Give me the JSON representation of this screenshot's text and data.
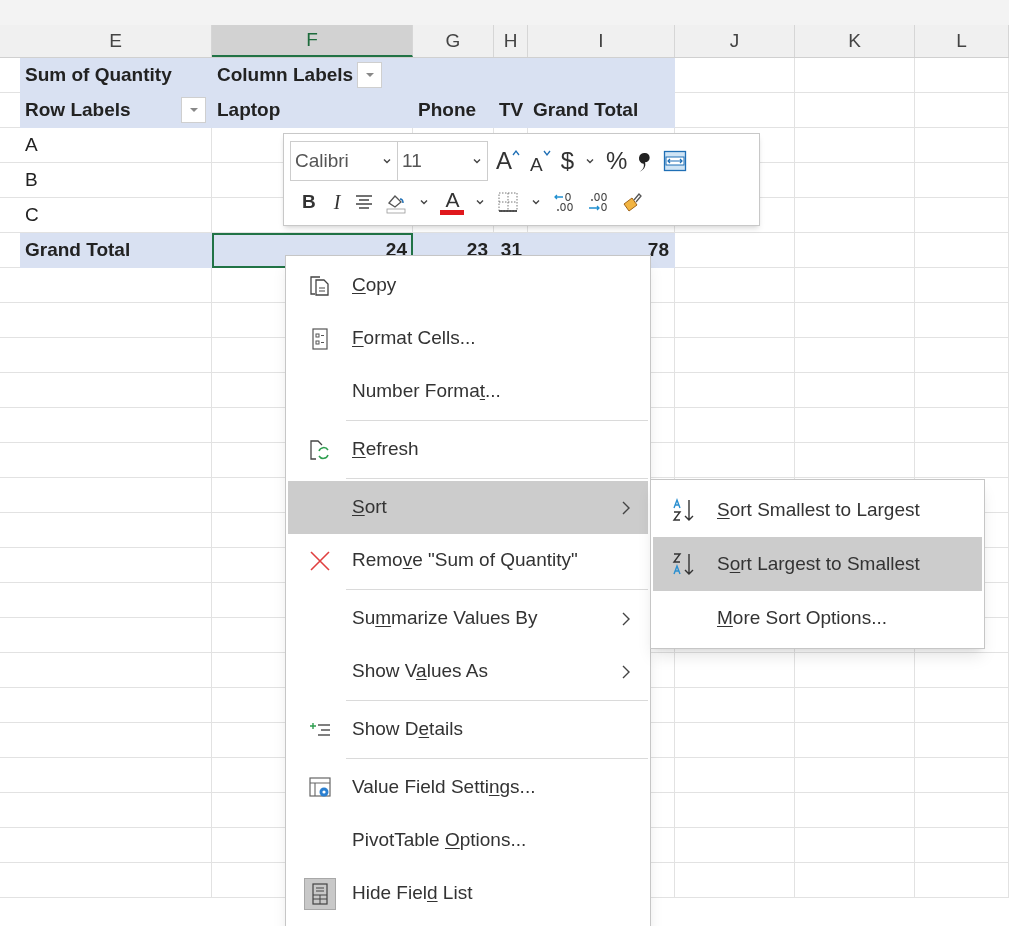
{
  "columns": [
    {
      "label": "E",
      "selected": false
    },
    {
      "label": "F",
      "selected": true
    },
    {
      "label": "G",
      "selected": false
    },
    {
      "label": "H",
      "selected": false
    },
    {
      "label": "I",
      "selected": false
    },
    {
      "label": "J",
      "selected": false
    },
    {
      "label": "K",
      "selected": false
    },
    {
      "label": "L",
      "selected": false
    }
  ],
  "pivot_rows": [
    {
      "kind": "header",
      "cells": [
        {
          "text": "Sum of Quantity",
          "selected": false
        },
        {
          "text": "Column Labels",
          "filter_button": true,
          "selected": false
        },
        null,
        null,
        null
      ]
    },
    {
      "kind": "header",
      "cells": [
        {
          "text": "Row Labels",
          "filter_button": true,
          "selected": false
        },
        {
          "text": "Laptop",
          "selected": false
        },
        {
          "text": "Phone",
          "selected": false
        },
        {
          "text": "TV",
          "selected": false
        },
        {
          "text": "Grand Total",
          "selected": false
        }
      ]
    },
    {
      "kind": "item",
      "cells": [
        {
          "text": "A",
          "selected": false
        }
      ]
    },
    {
      "kind": "item",
      "cells": [
        {
          "text": "B",
          "selected": false
        }
      ]
    },
    {
      "kind": "item",
      "cells": [
        {
          "text": "C",
          "selected": false
        }
      ]
    },
    {
      "kind": "total",
      "cells": [
        {
          "text": "Grand Total",
          "selected": false
        },
        {
          "text": "24",
          "selected": true
        },
        {
          "text": "23",
          "selected": false
        },
        {
          "text": "31",
          "selected": false
        },
        {
          "text": "78",
          "selected": false
        }
      ]
    }
  ],
  "mini_toolbar": {
    "font": {
      "value": "Calibri"
    },
    "size": {
      "value": "11"
    },
    "row_1": [
      {
        "kind": "grow_font",
        "text": "A"
      },
      {
        "kind": "shrink_font",
        "text": "A"
      },
      {
        "kind": "currency",
        "text": "$"
      },
      {
        "kind": "caret"
      },
      {
        "kind": "percent",
        "text": "%"
      },
      {
        "kind": "comma"
      },
      {
        "kind": "merge"
      }
    ],
    "row_2": [
      {
        "kind": "bold",
        "text": "B"
      },
      {
        "kind": "italic",
        "text": "I"
      },
      {
        "kind": "align"
      },
      {
        "kind": "fill"
      },
      {
        "kind": "caret"
      },
      {
        "kind": "font_color",
        "text": "A"
      },
      {
        "kind": "caret"
      },
      {
        "kind": "borders"
      },
      {
        "kind": "caret"
      },
      {
        "kind": "decrease_decimal"
      },
      {
        "kind": "increase_decimal"
      },
      {
        "kind": "format_painter"
      }
    ]
  },
  "context_menu": [
    {
      "kind": "copy",
      "label": {
        "key": "C",
        "after": "opy"
      },
      "submenu": false,
      "selected": false,
      "checked": false,
      "separator_after": false
    },
    {
      "kind": "format_cells",
      "label": {
        "key": "F",
        "after": "ormat Cells..."
      },
      "submenu": false,
      "selected": false,
      "checked": false,
      "separator_after": false
    },
    {
      "label": {
        "before": "Number Forma",
        "key": "t",
        "after": "..."
      },
      "submenu": false,
      "selected": false,
      "checked": false,
      "separator_after": true
    },
    {
      "kind": "refresh",
      "label": {
        "key": "R",
        "after": "efresh"
      },
      "submenu": false,
      "selected": false,
      "checked": false,
      "separator_after": true
    },
    {
      "label": {
        "key": "S",
        "after": "ort"
      },
      "submenu": true,
      "selected": true,
      "checked": false,
      "separator_after": false
    },
    {
      "kind": "remove",
      "label": {
        "before": "Remo",
        "key": "v",
        "after": "e \"Sum of Quantity\""
      },
      "submenu": false,
      "selected": false,
      "checked": false,
      "separator_after": true
    },
    {
      "label": {
        "before": "Su",
        "key": "m",
        "after": "marize Values By"
      },
      "submenu": true,
      "selected": false,
      "checked": false,
      "separator_after": false
    },
    {
      "label": {
        "before": "Show V",
        "key": "a",
        "after": "lues As"
      },
      "submenu": true,
      "selected": false,
      "checked": false,
      "separator_after": true
    },
    {
      "kind": "show_details",
      "label": {
        "before": "Show D",
        "key": "e",
        "after": "tails"
      },
      "submenu": false,
      "selected": false,
      "checked": false,
      "separator_after": true
    },
    {
      "kind": "value_field_settings",
      "label": {
        "before": "Value Field Setti",
        "key": "n",
        "after": "gs..."
      },
      "submenu": false,
      "selected": false,
      "checked": false,
      "separator_after": false
    },
    {
      "label": {
        "before": "PivotTable ",
        "key": "O",
        "after": "ptions..."
      },
      "submenu": false,
      "selected": false,
      "checked": false,
      "separator_after": false
    },
    {
      "kind": "field_list",
      "label": {
        "before": "Hide Fiel",
        "key": "d",
        "after": " List"
      },
      "submenu": false,
      "selected": false,
      "checked": true,
      "separator_after": false
    }
  ],
  "sort_submenu": [
    {
      "kind": "sort_ascending",
      "label": {
        "key": "S",
        "after": "ort Smallest to Largest"
      },
      "selected": false
    },
    {
      "kind": "sort_descending",
      "label": {
        "before": "S",
        "key": "o",
        "after": "rt Largest to Smallest"
      },
      "selected": true
    },
    {
      "label": {
        "key": "M",
        "after": "ore Sort Options..."
      },
      "selected": false
    }
  ]
}
